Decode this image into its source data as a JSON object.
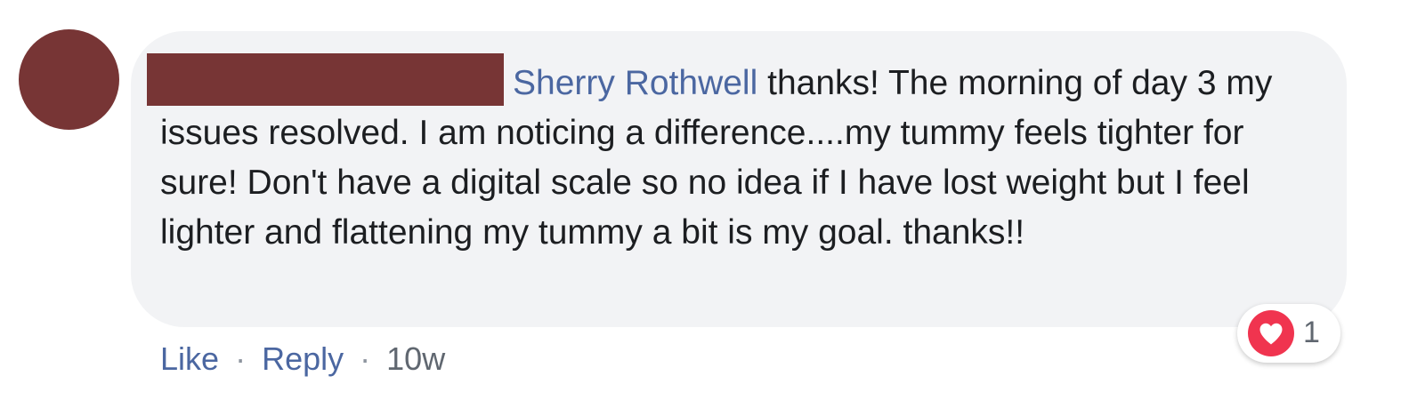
{
  "comment": {
    "author": "Sherry Rothwell",
    "text": " thanks! The morning of day 3 my issues resolved. I am noticing a difference....my tummy feels tighter for sure! Don't have a digital scale so no idea if I have lost weight but I feel lighter and flattening my tummy a bit is my goal. thanks!!",
    "avatar_color": "#773535",
    "redaction_color": "#773535",
    "bubble_color": "#f2f3f5",
    "link_color": "#4b67a1"
  },
  "actions": {
    "like": "Like",
    "separator": "·",
    "reply": "Reply",
    "timestamp": "10w"
  },
  "reactions": {
    "icon": "heart-icon",
    "count": "1",
    "color": "#f0344f"
  }
}
